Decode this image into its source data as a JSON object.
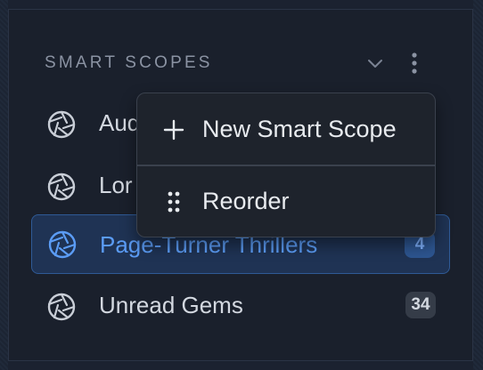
{
  "section": {
    "title": "SMART SCOPES",
    "collapse_icon": "chevron-down-icon",
    "more_icon": "more-vertical-icon"
  },
  "scopes": [
    {
      "label": "Aud",
      "icon": "aperture-icon",
      "count": "",
      "selected": false
    },
    {
      "label": "Lor",
      "icon": "aperture-icon",
      "count": "",
      "selected": false
    },
    {
      "label": "Page-Turner Thrillers",
      "icon": "aperture-icon",
      "count": "4",
      "selected": true
    },
    {
      "label": "Unread Gems",
      "icon": "aperture-icon",
      "count": "34",
      "selected": false
    }
  ],
  "menu": {
    "items": [
      {
        "label": "New Smart Scope",
        "icon": "plus-icon"
      },
      {
        "label": "Reorder",
        "icon": "drag-handle-icon"
      }
    ]
  },
  "colors": {
    "background": "#1a202c",
    "accent": "#5b9cf5",
    "selected_bg": "#1f3354",
    "menu_bg": "#1e232c"
  }
}
